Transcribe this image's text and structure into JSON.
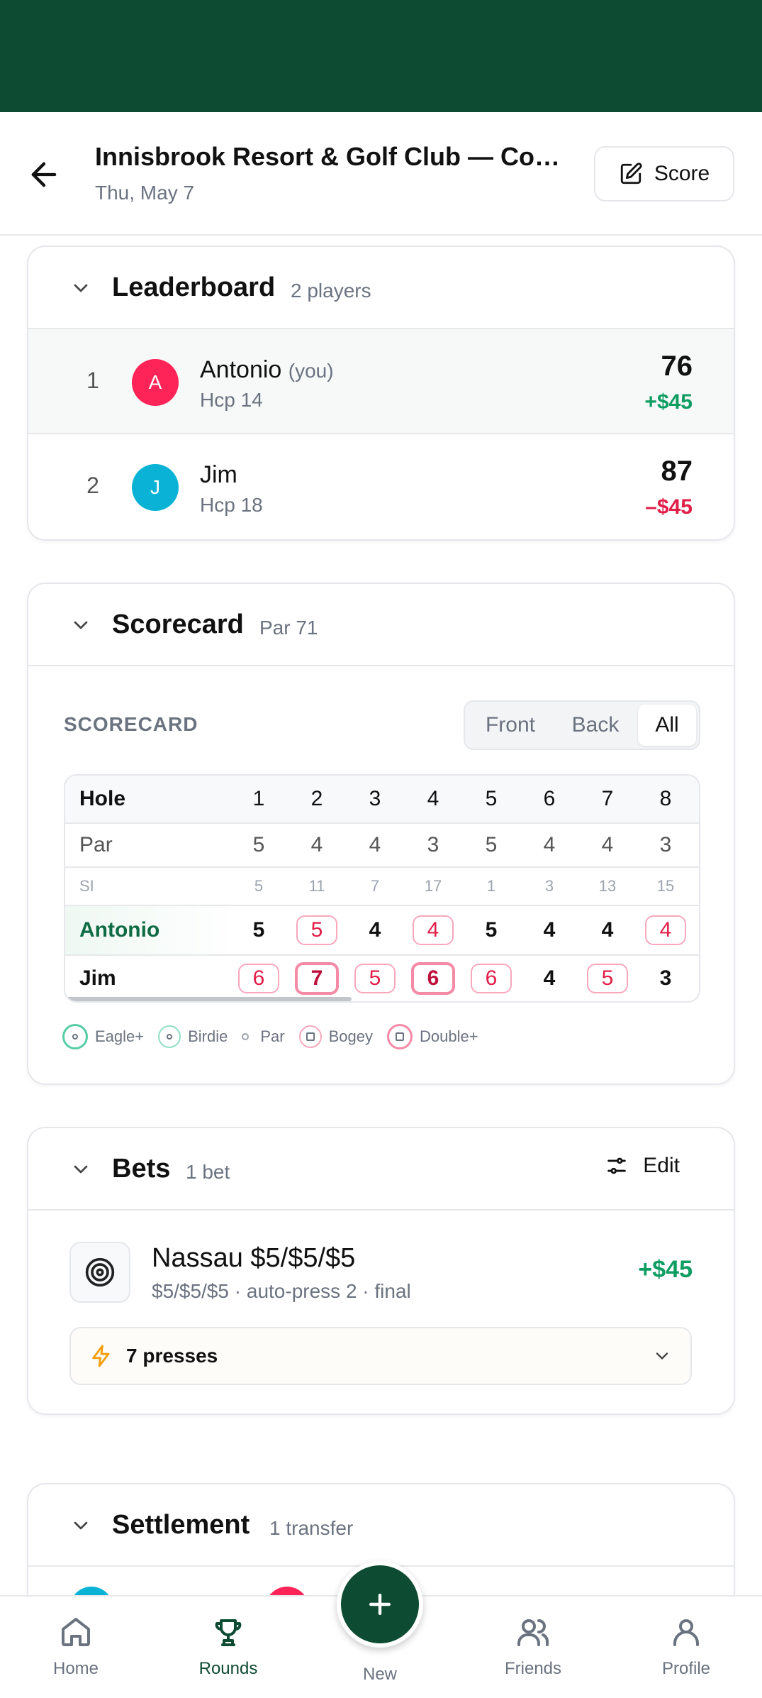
{
  "header": {
    "title": "Innisbrook Resort & Golf Club — Co…",
    "date": "Thu, May 7",
    "score_label": "Score"
  },
  "leaderboard": {
    "title": "Leaderboard",
    "meta": "2 players",
    "players": [
      {
        "rank": "1",
        "initial": "A",
        "name": "Antonio",
        "you": "(you)",
        "hcp": "Hcp 14",
        "total": "76",
        "money": "+$45",
        "avatar_color": "#ff2457",
        "money_color": "#0f9d62"
      },
      {
        "rank": "2",
        "initial": "J",
        "name": "Jim",
        "you": "",
        "hcp": "Hcp 18",
        "total": "87",
        "money": "–$45",
        "avatar_color": "#0ab3d6",
        "money_color": "#e11d48"
      }
    ]
  },
  "scorecard": {
    "title": "Scorecard",
    "meta": "Par 71",
    "label": "SCORECARD",
    "segments": [
      "Front",
      "Back",
      "All"
    ],
    "selected_segment": "All",
    "hole_label": "Hole",
    "par_label": "Par",
    "si_label": "SI",
    "holes": [
      "1",
      "2",
      "3",
      "4",
      "5",
      "6",
      "7",
      "8"
    ],
    "par": [
      "5",
      "4",
      "4",
      "3",
      "5",
      "4",
      "4",
      "3"
    ],
    "si": [
      "5",
      "11",
      "7",
      "17",
      "1",
      "3",
      "13",
      "15"
    ],
    "players": [
      {
        "name": "Antonio",
        "scores": [
          "5",
          "5",
          "4",
          "4",
          "5",
          "4",
          "4",
          "4"
        ],
        "marks": [
          "par",
          "bogey",
          "par",
          "bogey",
          "par",
          "par",
          "par",
          "bogey"
        ]
      },
      {
        "name": "Jim",
        "scores": [
          "6",
          "7",
          "5",
          "6",
          "6",
          "4",
          "5",
          "3"
        ],
        "marks": [
          "bogey",
          "double",
          "bogey",
          "double",
          "bogey",
          "par",
          "bogey",
          "par"
        ]
      }
    ],
    "legend": {
      "eagle": "Eagle+",
      "birdie": "Birdie",
      "par": "Par",
      "bogey": "Bogey",
      "double": "Double+"
    }
  },
  "bets": {
    "title": "Bets",
    "meta": "1 bet",
    "edit_label": "Edit",
    "bet_name": "Nassau $5/$5/$5",
    "bet_desc": "$5/$5/$5 · auto-press 2 · final",
    "bet_amount": "+$45",
    "presses_label": "7 presses"
  },
  "settlement": {
    "title": "Settlement",
    "meta": "1 transfer"
  },
  "nav": {
    "home": "Home",
    "rounds": "Rounds",
    "new": "New",
    "friends": "Friends",
    "profile": "Profile",
    "active": "Rounds"
  },
  "colors": {
    "brand": "#0e4b33",
    "positive": "#0f9d62",
    "negative": "#e11d48"
  }
}
